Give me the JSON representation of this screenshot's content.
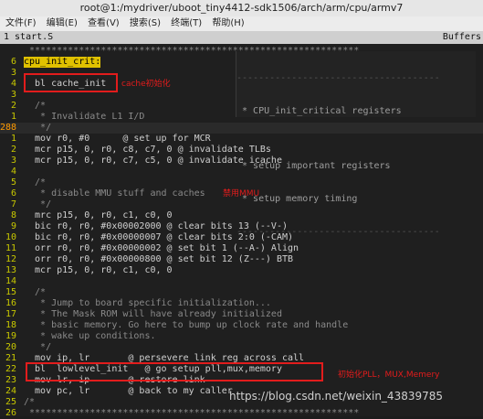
{
  "window": {
    "title": "root@1:/mydriver/uboot_tiny4412-sdk1506/arch/arm/cpu/armv7"
  },
  "menu": [
    "文件(F)",
    "编辑(E)",
    "查看(V)",
    "搜索(S)",
    "终端(T)",
    "帮助(H)"
  ],
  "tabs": {
    "left": "1 start.S",
    "right": "Buffers"
  },
  "popup_lines": [
    " * CPU_init_critical registers",
    "",
    " * setup important registers",
    " * setup memory timing"
  ],
  "lines": [
    {
      "n": "",
      "t": " ************************************************************"
    },
    {
      "n": "6",
      "t": "cpu_init_crit:",
      "label": true
    },
    {
      "n": "3",
      "t": ""
    },
    {
      "n": "4",
      "t": "  bl cache_init"
    },
    {
      "n": "3",
      "t": ""
    },
    {
      "n": "2",
      "t": "  /*"
    },
    {
      "n": "1",
      "t": "   * Invalidate L1 I/D"
    },
    {
      "n": "288",
      "t": "   */",
      "cur": true
    },
    {
      "n": "1",
      "t": "  mov r0, #0      @ set up for MCR"
    },
    {
      "n": "2",
      "t": "  mcr p15, 0, r0, c8, c7, 0 @ invalidate TLBs"
    },
    {
      "n": "3",
      "t": "  mcr p15, 0, r0, c7, c5, 0 @ invalidate icache"
    },
    {
      "n": "4",
      "t": ""
    },
    {
      "n": "5",
      "t": "  /*"
    },
    {
      "n": "6",
      "t": "   * disable MMU stuff and caches"
    },
    {
      "n": "7",
      "t": "   */"
    },
    {
      "n": "8",
      "t": "  mrc p15, 0, r0, c1, c0, 0"
    },
    {
      "n": "9",
      "t": "  bic r0, r0, #0x00002000 @ clear bits 13 (--V-)"
    },
    {
      "n": "10",
      "t": "  bic r0, r0, #0x00000007 @ clear bits 2:0 (-CAM)"
    },
    {
      "n": "11",
      "t": "  orr r0, r0, #0x00000002 @ set bit 1 (--A-) Align"
    },
    {
      "n": "12",
      "t": "  orr r0, r0, #0x00000800 @ set bit 12 (Z---) BTB"
    },
    {
      "n": "13",
      "t": "  mcr p15, 0, r0, c1, c0, 0"
    },
    {
      "n": "14",
      "t": ""
    },
    {
      "n": "15",
      "t": "  /*"
    },
    {
      "n": "16",
      "t": "   * Jump to board specific initialization..."
    },
    {
      "n": "17",
      "t": "   * The Mask ROM will have already initialized"
    },
    {
      "n": "18",
      "t": "   * basic memory. Go here to bump up clock rate and handle"
    },
    {
      "n": "19",
      "t": "   * wake up conditions."
    },
    {
      "n": "20",
      "t": "   */"
    },
    {
      "n": "21",
      "t": "  mov ip, lr       @ persevere link reg across call"
    },
    {
      "n": "22",
      "t": "  bl  lowlevel_init   @ go setup pll,mux,memory"
    },
    {
      "n": "23",
      "t": "  mov lr, ip       @ restore link"
    },
    {
      "n": "24",
      "t": "  mov pc, lr       @ back to my caller"
    },
    {
      "n": "25",
      "t": "/*"
    },
    {
      "n": "26",
      "t": " ************************************************************"
    }
  ],
  "annotations": {
    "cache": "cache初始化",
    "mmu": "禁用MMU",
    "lowlevel": "初始化PLL，MUX,Memery"
  },
  "watermark": "https://blog.csdn.net/weixin_43839785"
}
